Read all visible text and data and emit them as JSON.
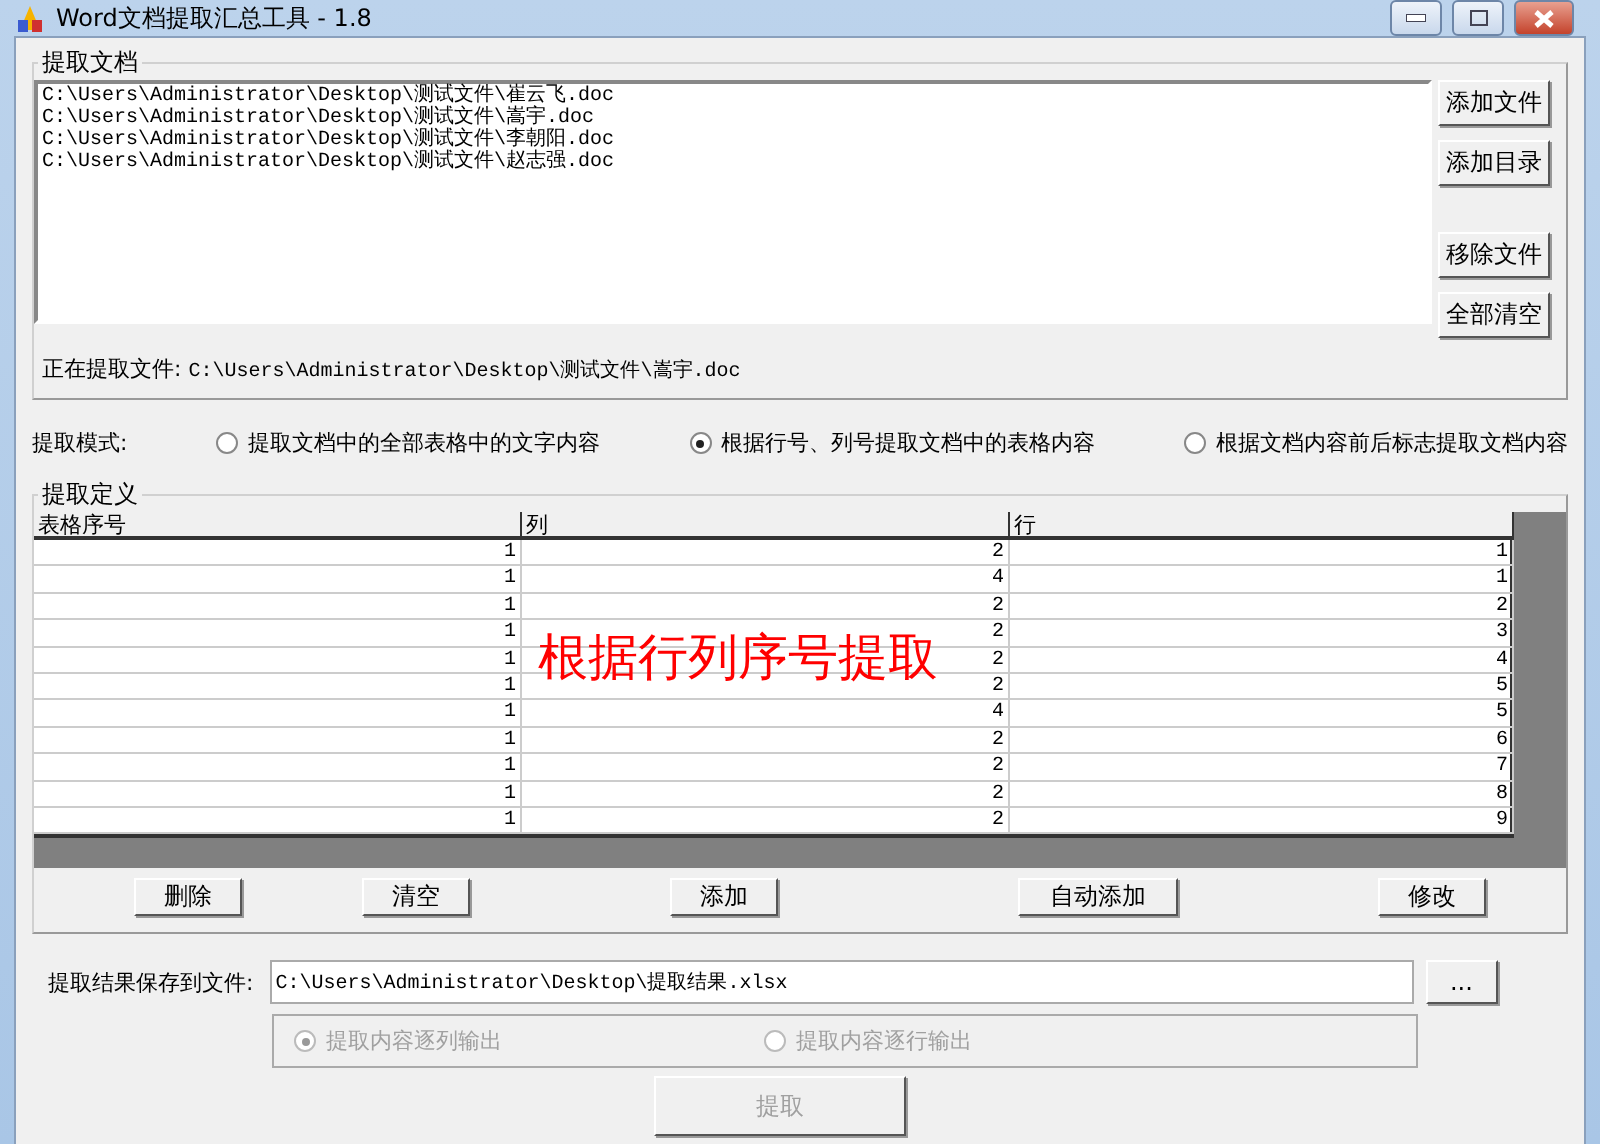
{
  "window": {
    "title": "Word文档提取汇总工具 - 1.8"
  },
  "documents": {
    "label": "提取文档",
    "files": [
      "C:\\Users\\Administrator\\Desktop\\测试文件\\崔云飞.doc",
      "C:\\Users\\Administrator\\Desktop\\测试文件\\嵩宇.doc",
      "C:\\Users\\Administrator\\Desktop\\测试文件\\李朝阳.doc",
      "C:\\Users\\Administrator\\Desktop\\测试文件\\赵志强.doc"
    ],
    "buttons": [
      "添加文件",
      "添加目录",
      "移除文件",
      "全部清空"
    ],
    "current_label": "正在提取文件:",
    "current_path": "C:\\Users\\Administrator\\Desktop\\测试文件\\嵩宇.doc"
  },
  "mode": {
    "label": "提取模式:",
    "options": [
      {
        "label": "提取文档中的全部表格中的文字内容",
        "selected": false
      },
      {
        "label": "根据行号、列号提取文档中的表格内容",
        "selected": true
      },
      {
        "label": "根据文档内容前后标志提取文档内容",
        "selected": false
      }
    ]
  },
  "definition": {
    "label": "提取定义",
    "columns": [
      "表格序号",
      "列",
      "行"
    ],
    "rows": [
      [
        "1",
        "2",
        "1"
      ],
      [
        "1",
        "4",
        "1"
      ],
      [
        "1",
        "2",
        "2"
      ],
      [
        "1",
        "2",
        "3"
      ],
      [
        "1",
        "2",
        "4"
      ],
      [
        "1",
        "2",
        "5"
      ],
      [
        "1",
        "4",
        "5"
      ],
      [
        "1",
        "2",
        "6"
      ],
      [
        "1",
        "2",
        "7"
      ],
      [
        "1",
        "2",
        "8"
      ],
      [
        "1",
        "2",
        "9"
      ]
    ],
    "note": "根据行列序号提取",
    "buttons": [
      "删除",
      "清空",
      "添加",
      "自动添加",
      "修改"
    ]
  },
  "save": {
    "label": "提取结果保存到文件:",
    "value": "C:\\Users\\Administrator\\Desktop\\提取结果.xlsx",
    "browse": "..."
  },
  "output": {
    "disabled": true,
    "options": [
      {
        "label": "提取内容逐列输出",
        "selected": true
      },
      {
        "label": "提取内容逐行输出",
        "selected": false
      }
    ]
  },
  "extract_button": {
    "label": "提取",
    "disabled": true
  }
}
